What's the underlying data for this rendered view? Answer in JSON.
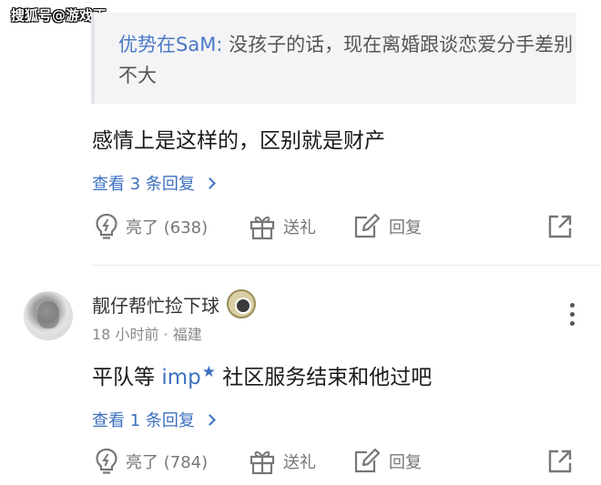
{
  "watermark": "搜狐号@游戏王",
  "quote": {
    "author": "优势在SaM:",
    "text": "没孩子的话，现在离婚跟谈恋爱分手差别不大"
  },
  "reply1": {
    "text": "感情上是这样的，区别就是财产",
    "view_replies": "查看 3 条回复",
    "likes": "亮了 (638)",
    "gift": "送礼",
    "reply": "回复"
  },
  "comment2": {
    "username": "靓仔帮忙捡下球",
    "meta": "18 小时前 · 福建",
    "text_before": "平队等",
    "mention": "imp",
    "mention_star": "★",
    "text_after": "社区服务结束和他过吧",
    "view_replies": "查看 1 条回复",
    "likes": "亮了 (784)",
    "gift": "送礼",
    "reply": "回复"
  },
  "icons": [
    "lightbulb-icon",
    "gift-icon",
    "edit-reply-icon",
    "share-icon",
    "more-vertical-icon"
  ],
  "colors": {
    "link": "#3d70c0",
    "quote_author": "#4a7ac7",
    "muted": "#777777"
  }
}
